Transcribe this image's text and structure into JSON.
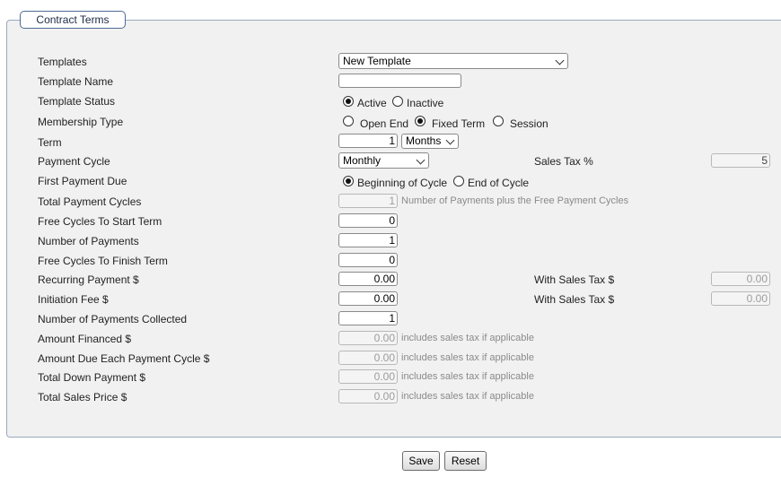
{
  "section_title": "Contract Terms",
  "labels": {
    "templates": "Templates",
    "template_name": "Template Name",
    "template_status": "Template Status",
    "membership_type": "Membership Type",
    "term": "Term",
    "payment_cycle": "Payment Cycle",
    "first_payment_due": "First Payment Due",
    "total_payment_cycles": "Total Payment Cycles",
    "free_cycles_start": "Free Cycles To Start Term",
    "number_of_payments": "Number of Payments",
    "free_cycles_finish": "Free Cycles To Finish Term",
    "recurring_payment": "Recurring Payment $",
    "initiation_fee": "Initiation Fee $",
    "payments_collected": "Number of Payments Collected",
    "amount_financed": "Amount Financed $",
    "amount_due_each_cycle": "Amount Due Each Payment Cycle $",
    "total_down_payment": "Total Down Payment $",
    "total_sales_price": "Total Sales Price $",
    "sales_tax_pct": "Sales Tax %",
    "with_sales_tax": "With Sales Tax $"
  },
  "values": {
    "template_select": "New Template",
    "template_name": "",
    "term": "1",
    "term_unit": "Months",
    "payment_cycle": "Monthly",
    "sales_tax_pct": "5",
    "total_payment_cycles": "1",
    "free_cycles_start": "0",
    "number_of_payments": "1",
    "free_cycles_finish": "0",
    "recurring_payment": "0.00",
    "recurring_with_tax": "0.00",
    "initiation_fee": "0.00",
    "initiation_with_tax": "0.00",
    "payments_collected": "1",
    "amount_financed": "0.00",
    "amount_due_each_cycle": "0.00",
    "total_down_payment": "0.00",
    "total_sales_price": "0.00"
  },
  "radios": {
    "status_active": "Active",
    "status_inactive": "Inactive",
    "open_end": "Open End",
    "fixed_term": "Fixed Term",
    "session": "Session",
    "beginning_of_cycle": "Beginning of Cycle",
    "end_of_cycle": "End of Cycle"
  },
  "notes": {
    "total_cycles_note": "Number of Payments plus the Free Payment Cycles",
    "tax_note": "includes sales tax if applicable"
  },
  "buttons": {
    "save": "Save",
    "reset": "Reset"
  },
  "icons": [
    "chevron-down-icon",
    "radio-icon"
  ]
}
